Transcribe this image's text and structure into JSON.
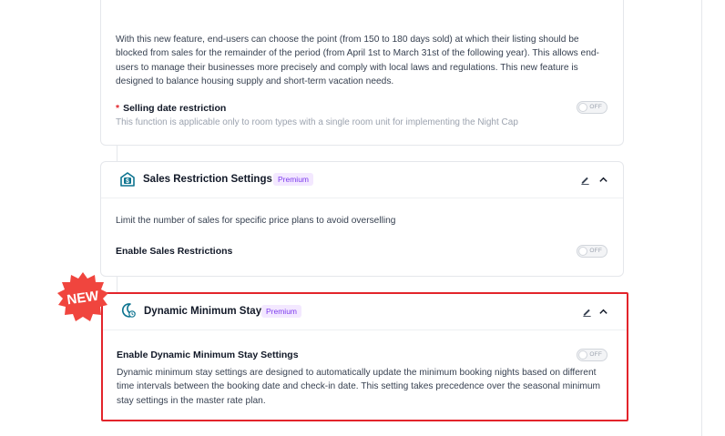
{
  "selling_date": {
    "description": "With this new feature, end-users can choose the point (from 150 to 180 days sold) at which their listing should be blocked from sales for the remainder of the period (from April 1st to March 31st of the following year). This allows end-users to manage their businesses more precisely and comply with local laws and regulations. This new feature is designed to balance housing supply and short-term vacation needs.",
    "required_mark": "*",
    "label": "Selling date restriction",
    "hint": "This function is applicable only to room types with a single room unit for implementing the Night Cap",
    "toggle_text": "OFF"
  },
  "sales_restriction": {
    "title": "Sales Restriction Settings",
    "badge": "Premium",
    "description": "Limit the number of sales for specific price plans to avoid overselling",
    "label": "Enable Sales Restrictions",
    "toggle_text": "OFF"
  },
  "dynamic_min_stay": {
    "new_label": "NEW",
    "title": "Dynamic Minimum Stay",
    "badge": "Premium",
    "label": "Enable Dynamic Minimum Stay Settings",
    "toggle_text": "OFF",
    "description": "Dynamic minimum stay settings are designed to automatically update the minimum booking nights based on different time intervals between the booking date and check-in date. This setting takes precedence over the seasonal minimum stay settings in the master rate plan."
  },
  "colors": {
    "highlight": "#e3242b",
    "badge_text": "#7c3aed",
    "badge_bg": "#f3e8ff",
    "icon_teal": "#0e7490"
  }
}
